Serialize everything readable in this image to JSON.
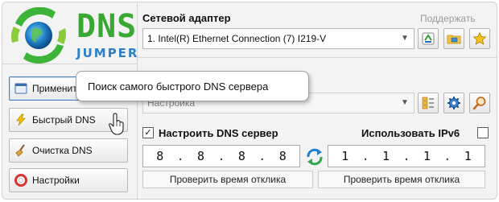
{
  "app": {
    "logo_title": "DNS",
    "logo_subtitle": "JUMPER"
  },
  "sidebar": {
    "buttons": [
      {
        "label": "Применить",
        "icon": "apply-icon"
      },
      {
        "label": "Быстрый DNS",
        "icon": "lightning-icon"
      },
      {
        "label": "Очистка DNS",
        "icon": "broom-icon"
      },
      {
        "label": "Настройки",
        "icon": "settings-lifebuoy-icon"
      }
    ]
  },
  "adapter": {
    "label": "Сетевой адаптер",
    "support_link": "Поддержать",
    "selected": "1. Intel(R) Ethernet Connection (7) I219-V",
    "buttons": [
      "refresh-adapter-icon",
      "network-folder-icon",
      "star-icon"
    ]
  },
  "dns_server": {
    "selected": "Настройка",
    "buttons": [
      "list-icon",
      "gear-icon",
      "search-icon"
    ]
  },
  "options": {
    "custom_dns_label": "Настроить DNS сервер",
    "custom_dns_checked": true,
    "ipv6_label": "Использовать IPv6",
    "ipv6_checked": false
  },
  "primary_dns": {
    "o1": "8",
    "o2": "8",
    "o3": "8",
    "o4": "8"
  },
  "secondary_dns": {
    "o1": "1",
    "o2": "1",
    "o3": "1",
    "o4": "1"
  },
  "ping": {
    "primary_label": "Проверить время отклика",
    "secondary_label": "Проверить время отклика"
  },
  "tooltip": {
    "text": "Поиск самого быстрого DNS сервера"
  },
  "colors": {
    "logo_green": "#38a832",
    "logo_blue": "#2d80c8",
    "selection_border": "#4a7fc0"
  }
}
